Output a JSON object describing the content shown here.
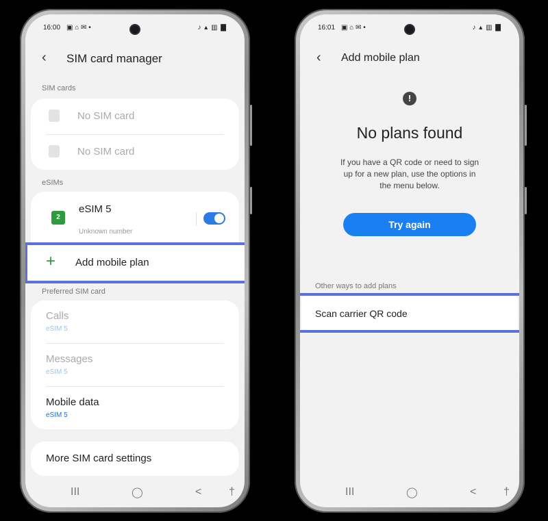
{
  "left_screen": {
    "status": {
      "time": "16:00",
      "icons": "▣ ⌂ ✉ •",
      "right_icons": "♪ ▴ ▥ ▇"
    },
    "header": {
      "back_icon": "chevron-left-icon",
      "title": "SIM card manager"
    },
    "sim_cards": {
      "section_label": "SIM cards",
      "items": [
        {
          "label": "No SIM card"
        },
        {
          "label": "No SIM card"
        }
      ]
    },
    "esims": {
      "section_label": "eSIMs",
      "item": {
        "badge": "2",
        "name": "eSIM 5",
        "number": "Unknown number",
        "enabled": true
      },
      "add_plan": {
        "icon": "plus-icon",
        "label": "Add mobile plan"
      }
    },
    "preferred": {
      "section_label": "Preferred SIM card",
      "rows": [
        {
          "label": "Calls",
          "value": "eSIM 5",
          "enabled": false
        },
        {
          "label": "Messages",
          "value": "eSIM 5",
          "enabled": false
        },
        {
          "label": "Mobile data",
          "value": "eSIM 5",
          "enabled": true
        }
      ]
    },
    "more_settings": {
      "label": "More SIM card settings"
    },
    "navbar": {
      "recents": "III",
      "home": "◯",
      "back": "<",
      "accessibility": "†"
    }
  },
  "right_screen": {
    "status": {
      "time": "16:01",
      "icons": "▣ ⌂ ✉ •",
      "right_icons": "♪ ▴ ▥ ▇"
    },
    "header": {
      "back_icon": "chevron-left-icon",
      "title": "Add mobile plan"
    },
    "alert_icon": "exclamation-icon",
    "heading": "No plans found",
    "message_lines": [
      "If you have a QR code or need to sign",
      "up for a new plan, use the options in",
      "the menu below."
    ],
    "try_again_label": "Try again",
    "other_ways": {
      "section_label": "Other ways to add plans",
      "scan_label": "Scan carrier QR code"
    },
    "navbar": {
      "recents": "III",
      "home": "◯",
      "back": "<",
      "accessibility": "†"
    }
  },
  "colors": {
    "highlight": "#5b73d9",
    "accent_blue": "#1a7ff0",
    "toggle_on": "#2c7be5",
    "esim_green": "#2e9c3e"
  }
}
